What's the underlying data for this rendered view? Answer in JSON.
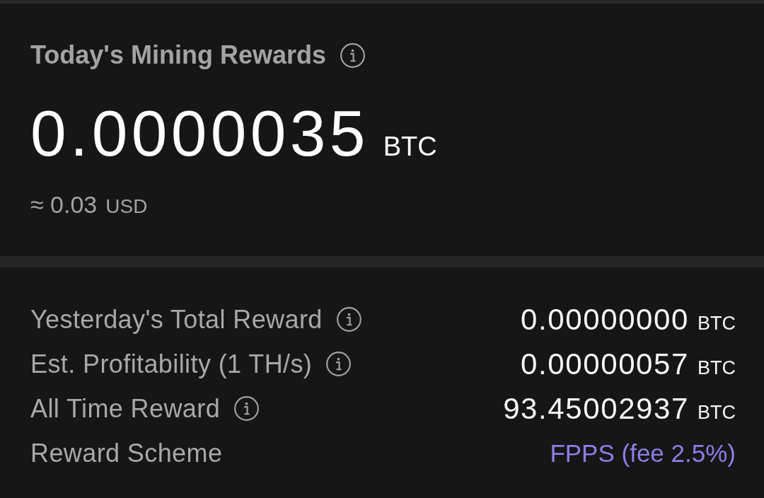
{
  "today": {
    "title": "Today's Mining Rewards",
    "info": true,
    "amount": "0.0000035",
    "unit": "BTC",
    "fiat_approx": "≈ 0.03",
    "fiat_unit": "USD"
  },
  "stats": [
    {
      "kind": "amount",
      "label": "Yesterday's Total Reward",
      "info": true,
      "value": "0.00000000",
      "unit": "BTC"
    },
    {
      "kind": "amount",
      "label": "Est. Profitability (1 TH/s)",
      "info": true,
      "value": "0.00000057",
      "unit": "BTC"
    },
    {
      "kind": "amount",
      "label": "All Time Reward",
      "info": true,
      "value": "93.45002937",
      "unit": "BTC"
    },
    {
      "kind": "link",
      "label": "Reward Scheme",
      "value": "FPPS (fee 2.5%)"
    }
  ]
}
